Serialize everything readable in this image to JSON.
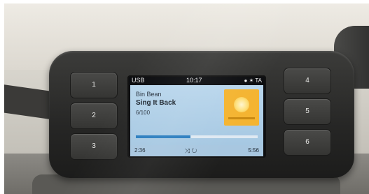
{
  "presets_left": [
    "1",
    "2",
    "3"
  ],
  "presets_right": [
    "4",
    "5",
    "6"
  ],
  "screen": {
    "source": "USB",
    "clock": "10:17",
    "status_icons": "● ✶ TA",
    "track": {
      "artist": "Bin Bean",
      "title": "Sing It Back",
      "count": "6/100"
    },
    "progress": 0.45,
    "elapsed": "2:36",
    "controls": "⤨ ↻",
    "total": "5:56"
  },
  "colors": {
    "panel_blue": "#a6c8e2",
    "accent_blue": "#2a7dbf",
    "album_art": "#f4b431",
    "bezel": "#262625"
  }
}
